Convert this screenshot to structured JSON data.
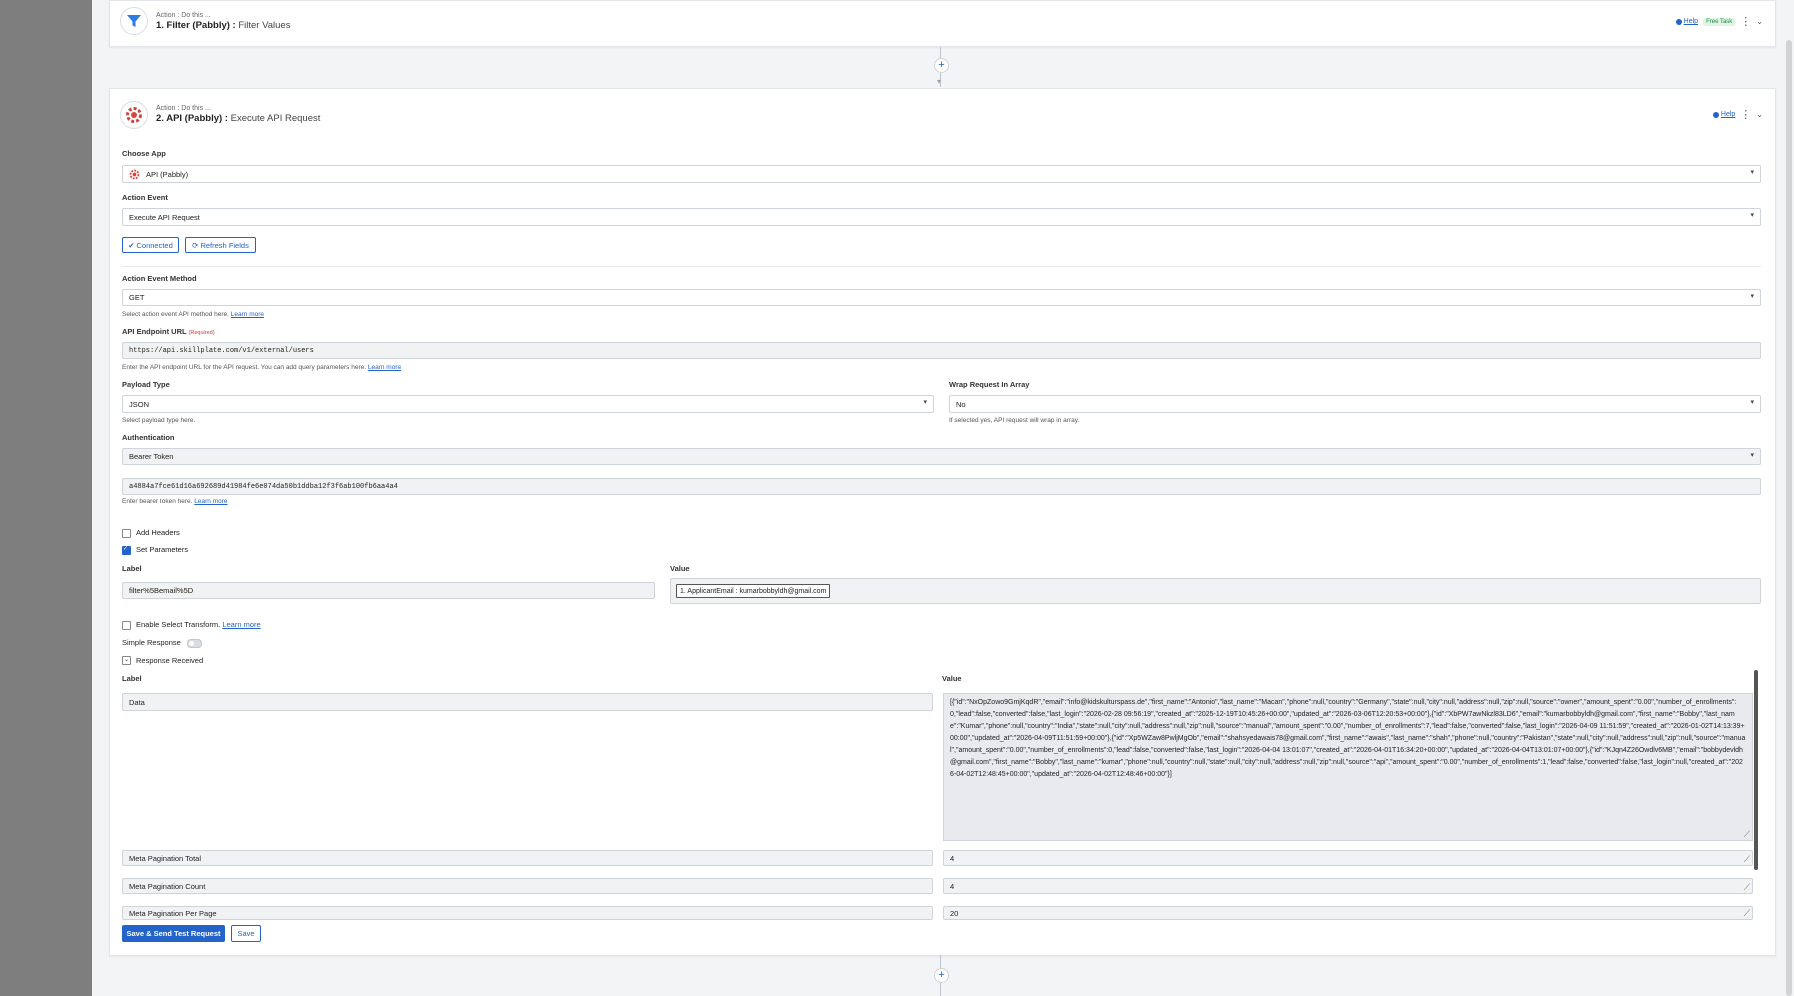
{
  "step1": {
    "sub": "Action : Do this ...",
    "title": "1. Filter (Pabbly) :",
    "event": "Filter Values",
    "help": "Help",
    "badge": "Free Task"
  },
  "step2": {
    "sub": "Action : Do this ...",
    "title": "2. API (Pabbly) :",
    "event": "Execute API Request",
    "help": "Help",
    "choose_app_label": "Choose App",
    "choose_app_value": "API (Pabbly)",
    "action_event_label": "Action Event",
    "action_event_value": "Execute API Request",
    "connected_label": "Connected",
    "refresh_label": "Refresh Fields",
    "method_label": "Action Event Method",
    "method_value": "GET",
    "method_hint": "Select action event API method here.",
    "learn_more": "Learn more",
    "endpoint_label": "API Endpoint URL",
    "required": "(Required)",
    "endpoint_value": "https://api.skillplate.com/v1/external/users",
    "endpoint_hint": "Enter the API endpoint URL for the API request. You can add query parameters here.",
    "payload_label": "Payload Type",
    "payload_value": "JSON",
    "payload_hint": "Select payload type here.",
    "wrap_label": "Wrap Request In Array",
    "wrap_value": "No",
    "wrap_hint": "If selected yes, API request will wrap in array.",
    "auth_label": "Authentication",
    "auth_value": "Bearer Token",
    "token_value": "a4884a7fce61d16a692689d41984fe6e074da50b1ddba12f3f6ab100fb6aa4a4",
    "token_hint": "Enter bearer token here.",
    "add_headers": "Add Headers",
    "set_params": "Set Parameters",
    "param_label_head": "Label",
    "param_value_head": "Value",
    "param_label_value": "filter%5Bemail%5D",
    "param_value_chip": "1. ApplicantEmail : kumarbobbyldh@gmail.com",
    "enable_transform": "Enable Select Transform.",
    "simple_response": "Simple Response",
    "response_received": "Response Received",
    "resp_label_head": "Label",
    "resp_value_head": "Value",
    "rows": [
      {
        "label": "Data",
        "value": "[{\"id\":\"NxOpZowo9GmjKqdR\",\"email\":\"info@kidskulturspass.de\",\"first_name\":\"Antonio\",\"last_name\":\"Macan\",\"phone\":null,\"country\":\"Germany\",\"state\":null,\"city\":null,\"address\":null,\"zip\":null,\"source\":\"owner\",\"amount_spent\":\"0.00\",\"number_of_enrollments\":0,\"lead\":false,\"converted\":false,\"last_login\":\"2026-02-28 09:56:19\",\"created_at\":\"2025-12-19T10:45:26+00:00\",\"updated_at\":\"2026-03-06T12:20:53+00:00\"},{\"id\":\"XbPW7awNkzl83LD6\",\"email\":\"kumarbobbyldh@gmail.com\",\"first_name\":\"Bobby\",\"last_name\":\"Kumar\",\"phone\":null,\"country\":\"India\",\"state\":null,\"city\":null,\"address\":null,\"zip\":null,\"source\":\"manual\",\"amount_spent\":\"0.00\",\"number_of_enrollments\":7,\"lead\":false,\"converted\":false,\"last_login\":\"2026-04-09 11:51:59\",\"created_at\":\"2026-01-02T14:13:39+00:00\",\"updated_at\":\"2026-04-09T11:51:59+00:00\"},{\"id\":\"Xp5WZaw8PwljMgOb\",\"email\":\"shahsyedawais78@gmail.com\",\"first_name\":\"awais\",\"last_name\":\"shah\",\"phone\":null,\"country\":\"Pakistan\",\"state\":null,\"city\":null,\"address\":null,\"zip\":null,\"source\":\"manual\",\"amount_spent\":\"0.00\",\"number_of_enrollments\":0,\"lead\":false,\"converted\":false,\"last_login\":\"2026-04-04 13:01:07\",\"created_at\":\"2026-04-01T16:34:20+00:00\",\"updated_at\":\"2026-04-04T13:01:07+00:00\"},{\"id\":\"KJqn4Z26Owdlv6MB\",\"email\":\"bobbydevldh@gmail.com\",\"first_name\":\"Bobby\",\"last_name\":\"kumar\",\"phone\":null,\"country\":null,\"state\":null,\"city\":null,\"address\":null,\"zip\":null,\"source\":\"api\",\"amount_spent\":\"0.00\",\"number_of_enrollments\":1,\"lead\":false,\"converted\":false,\"last_login\":null,\"created_at\":\"2026-04-02T12:48:45+00:00\",\"updated_at\":\"2026-04-02T12:48:46+00:00\"}]"
      },
      {
        "label": "Meta Pagination Total",
        "value": "4"
      },
      {
        "label": "Meta Pagination Count",
        "value": "4"
      },
      {
        "label": "Meta Pagination Per Page",
        "value": "20"
      }
    ],
    "save_send": "Save & Send Test Request",
    "save": "Save"
  },
  "colors": {
    "accent": "#2463c9",
    "filter_icon": "#2d7be5",
    "api_icon": "#d64541"
  }
}
